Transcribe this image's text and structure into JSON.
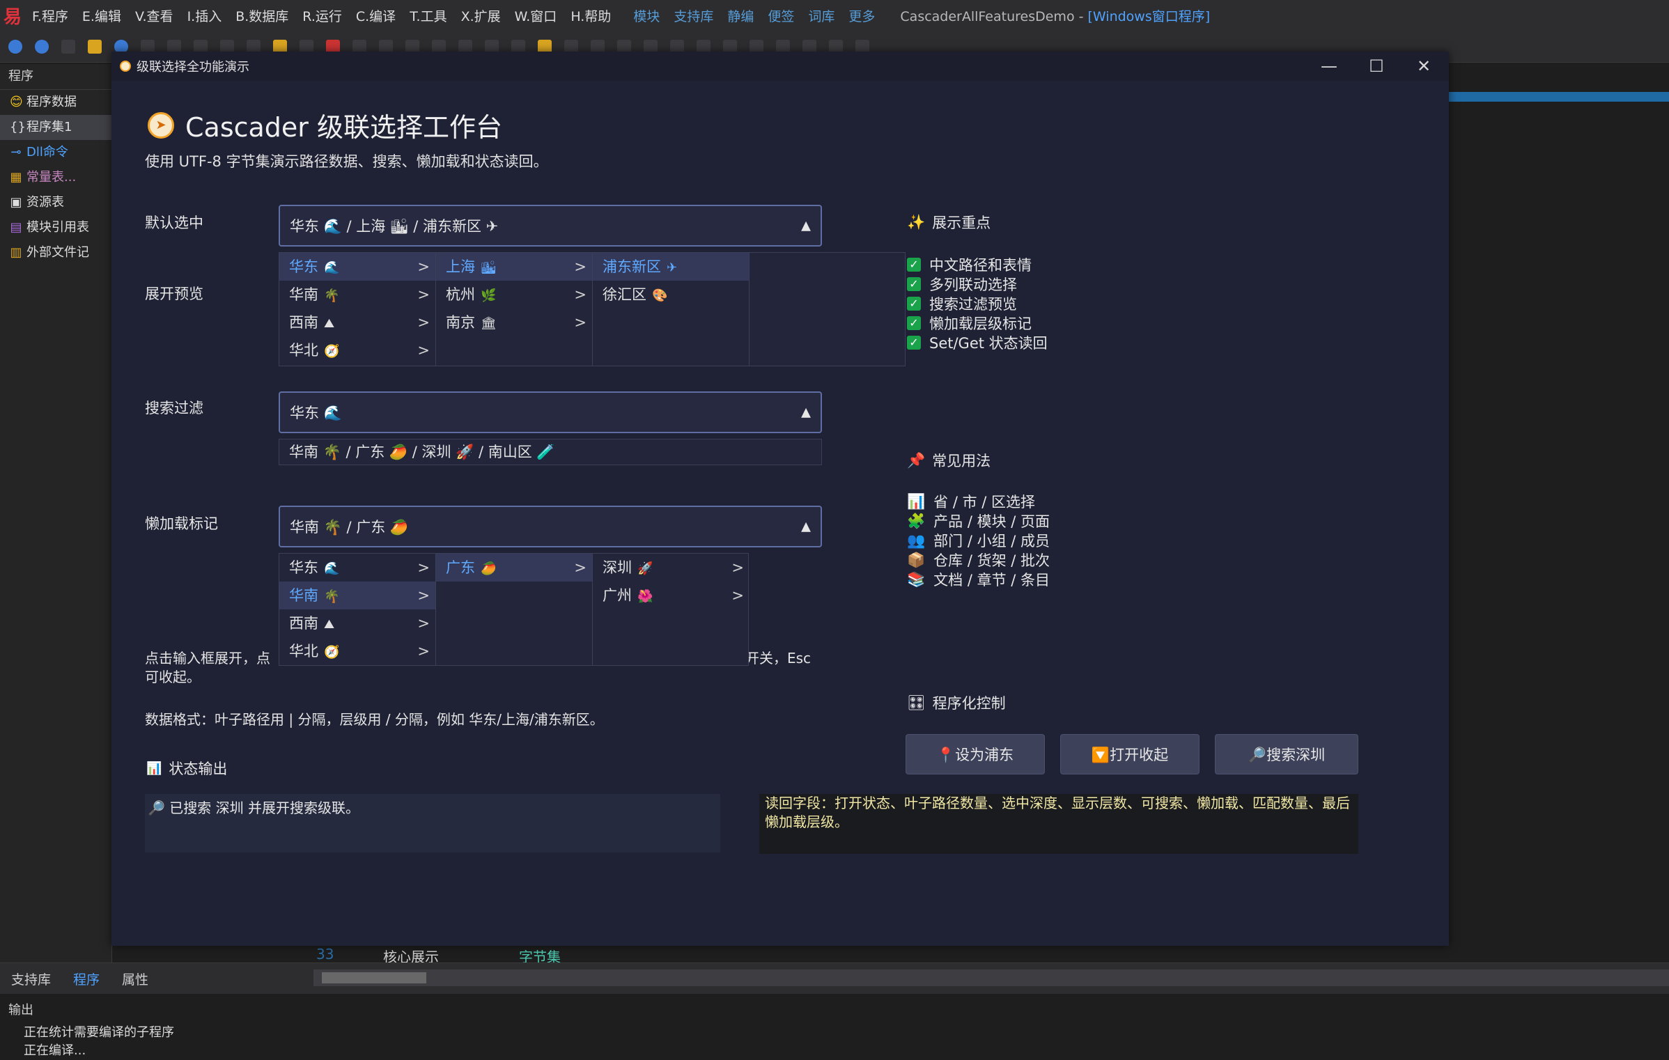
{
  "ide": {
    "menu": [
      "F.程序",
      "E.编辑",
      "V.查看",
      "I.插入",
      "B.数据库",
      "R.运行",
      "C.编译",
      "T.工具",
      "X.扩展",
      "W.窗口",
      "H.帮助"
    ],
    "ext_menu": [
      "模块",
      "支持库",
      "静编",
      "便签",
      "词库",
      "更多"
    ],
    "title_prefix": "CascaderAllFeaturesDemo - ",
    "title_suffix": "[Windows窗口程序]",
    "left_header": "程序",
    "tree": [
      {
        "icon": "😊",
        "label": "程序数据"
      },
      {
        "icon": "{}",
        "label": "程序集1"
      },
      {
        "icon": "⊸",
        "label": "Dll命令"
      },
      {
        "icon": "▦",
        "label": "常量表..."
      },
      {
        "icon": "▣",
        "label": "资源表"
      },
      {
        "icon": "▤",
        "label": "模块引用表"
      },
      {
        "icon": "▥",
        "label": "外部文件记"
      }
    ],
    "bottom_tabs": [
      "支持库",
      "程序",
      "属性"
    ],
    "editor_strip": {
      "line": "33",
      "tab1": "核心展示",
      "tab2": "字节集"
    },
    "output_header": "输出",
    "output_lines": [
      "正在统计需要编译的子程序",
      "正在编译..."
    ]
  },
  "window": {
    "title": "级联选择全功能演示",
    "heading": "Cascader 级联选择工作台",
    "subtitle": "使用 UTF-8 字节集演示路径数据、搜索、懒加载和状态读回。",
    "label_default": "默认选中",
    "label_expand": "展开预览",
    "label_search": "搜索过滤",
    "label_lazy": "懒加载标记",
    "combo_default": "华东 🌊 / 上海 🏙 / 浦东新区 ✈",
    "combo_search": "华东 🌊",
    "combo_lazy": "华南 🌴 / 广东 🥭",
    "arrow": "▲",
    "expand_col1": [
      {
        "label": "华东",
        "emoji": "🌊"
      },
      {
        "label": "华南",
        "emoji": "🌴"
      },
      {
        "label": "西南",
        "emoji": "⛰"
      },
      {
        "label": "华北",
        "emoji": "🧭"
      }
    ],
    "expand_col2": [
      {
        "label": "上海",
        "emoji": "🏙"
      },
      {
        "label": "杭州",
        "emoji": "🌿"
      },
      {
        "label": "南京",
        "emoji": "🏛"
      }
    ],
    "expand_col3": [
      {
        "label": "浦东新区",
        "emoji": "✈"
      },
      {
        "label": "徐汇区",
        "emoji": "🎨"
      }
    ],
    "search_suggestion": "华南 🌴 / 广东 🥭 / 深圳 🚀 / 南山区 🧪",
    "lazy_col1": [
      {
        "label": "华东",
        "emoji": "🌊"
      },
      {
        "label": "华南",
        "emoji": "🌴"
      },
      {
        "label": "西南",
        "emoji": "⛰"
      },
      {
        "label": "华北",
        "emoji": "🧭"
      }
    ],
    "lazy_col2": [
      {
        "label": "广东",
        "emoji": "🥭"
      }
    ],
    "lazy_col3": [
      {
        "label": "深圳",
        "emoji": "🚀"
      },
      {
        "label": "广州",
        "emoji": "🌺"
      }
    ],
    "chevron": ">",
    "help_line1": "点击输入框展开，点",
    "help_line1_right": "开关，Esc",
    "help_line2": "可收起。",
    "data_format": "数据格式：叶子路径用 | 分隔，层级用 / 分隔，例如 华东/上海/浦东新区。",
    "status_title": "状态输出",
    "status_text": "🔎 已搜索 深圳 并展开搜索级联。",
    "readback": "读回字段：打开状态、叶子路径数量、选中深度、显示层数、可搜索、懒加载、匹配数量、最后懒加载层级。",
    "highlights_title": "展示重点",
    "highlights": [
      "中文路径和表情",
      "多列联动选择",
      "搜索过滤预览",
      "懒加载层级标记",
      "Set/Get 状态读回"
    ],
    "usage_title": "常见用法",
    "usages": [
      {
        "icon": "📊",
        "label": "省 / 市 / 区选择"
      },
      {
        "icon": "🧩",
        "label": "产品 / 模块 / 页面"
      },
      {
        "icon": "👥",
        "label": "部门 / 小组 / 成员"
      },
      {
        "icon": "📦",
        "label": "仓库 / 货架 / 批次"
      },
      {
        "icon": "📚",
        "label": "文档 / 章节 / 条目"
      }
    ],
    "control_title": "程序化控制",
    "btn_pudong": "📍设为浦东",
    "btn_toggle": "🔽打开收起",
    "btn_shenzhen": "🔎搜索深圳"
  }
}
